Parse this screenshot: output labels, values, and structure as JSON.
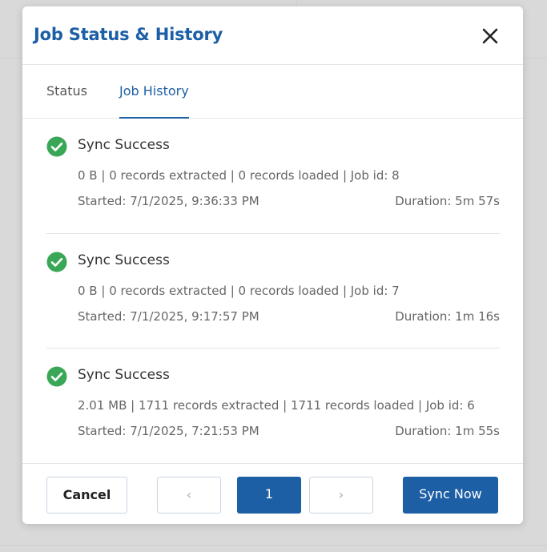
{
  "modal": {
    "title": "Job Status & History",
    "close_icon": "close-icon"
  },
  "tabs": [
    {
      "label": "Status",
      "active": false
    },
    {
      "label": "Job History",
      "active": true
    }
  ],
  "jobs": [
    {
      "status": "Sync Success",
      "status_icon": "check-circle-icon",
      "meta": "0 B | 0 records extracted | 0 records loaded | Job id: 8",
      "started": "Started: 7/1/2025, 9:36:33 PM",
      "duration": "Duration: 5m 57s"
    },
    {
      "status": "Sync Success",
      "status_icon": "check-circle-icon",
      "meta": "0 B | 0 records extracted | 0 records loaded | Job id: 7",
      "started": "Started: 7/1/2025, 9:17:57 PM",
      "duration": "Duration: 1m 16s"
    },
    {
      "status": "Sync Success",
      "status_icon": "check-circle-icon",
      "meta": "2.01 MB | 1711 records extracted | 1711 records loaded | Job id: 6",
      "started": "Started: 7/1/2025, 7:21:53 PM",
      "duration": "Duration: 1m 55s"
    }
  ],
  "footer": {
    "cancel_label": "Cancel",
    "prev_label": "‹",
    "page_label": "1",
    "next_label": "›",
    "sync_label": "Sync Now"
  },
  "colors": {
    "accent": "#1d5fa5",
    "success": "#3aa757"
  }
}
